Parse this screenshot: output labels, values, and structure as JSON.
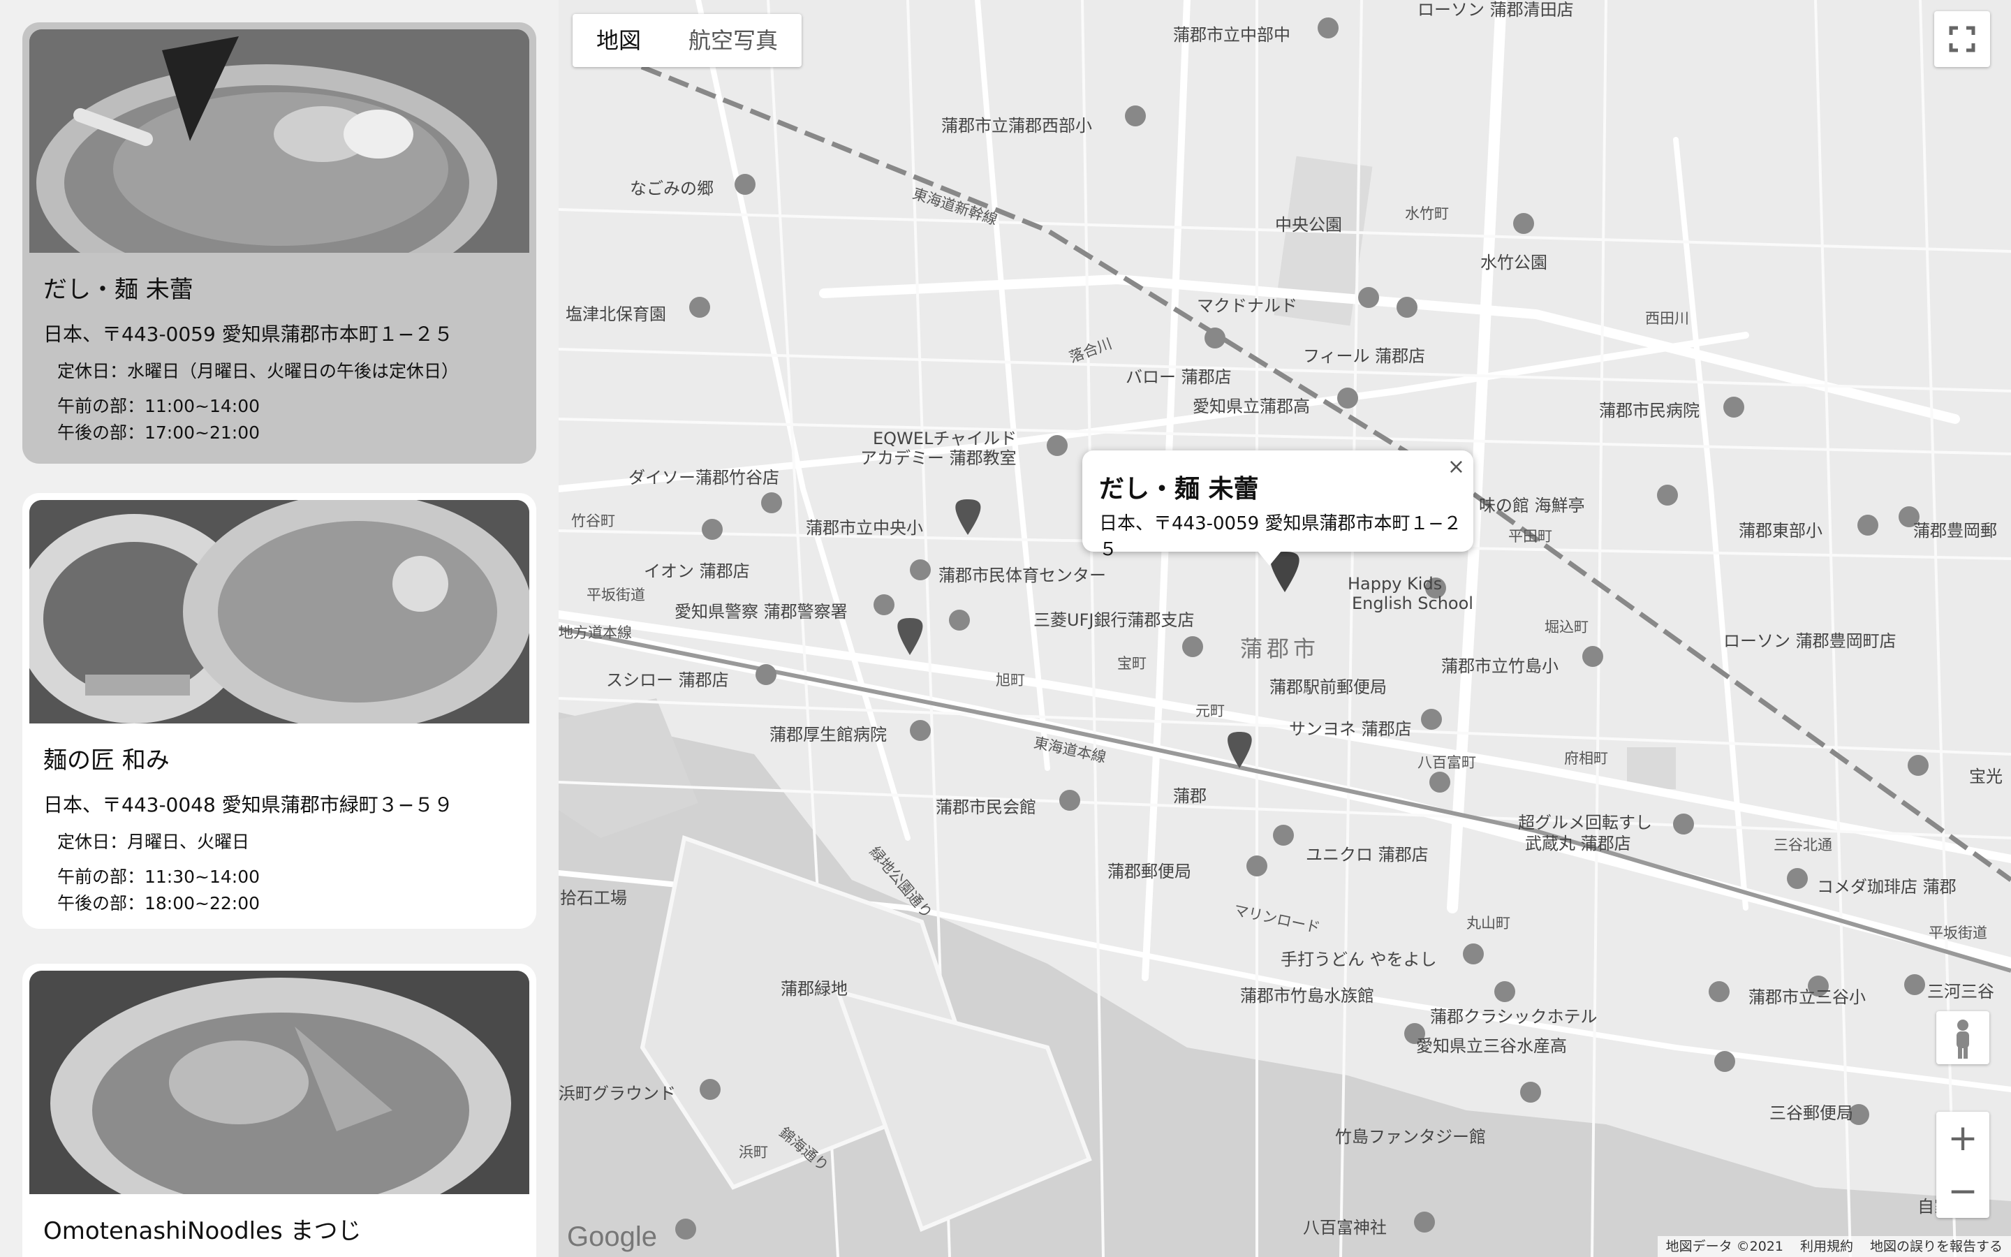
{
  "restaurants": [
    {
      "name": "だし・麺 未蕾",
      "address": "日本、〒443-0059 愛知県蒲郡市本町１−２５",
      "holiday": "定休日：水曜日（月曜日、火曜日の午後は定休日）",
      "am": "午前の部：11:00~14:00",
      "pm": "午後の部：17:00~21:00"
    },
    {
      "name": "麺の匠 和み",
      "address": "日本、〒443-0048 愛知県蒲郡市緑町３−５９",
      "holiday": "定休日：月曜日、火曜日",
      "am": "午前の部：11:30~14:00",
      "pm": "午後の部：18:00~22:00"
    },
    {
      "name": "OmotenashiNoodles まつじ"
    }
  ],
  "map": {
    "type_buttons": [
      "地図",
      "航空写真"
    ],
    "info": {
      "title": "だし・麺 未蕾",
      "address": "日本、〒443-0059 愛知県蒲郡市本町１−２５",
      "close": "×"
    },
    "labels": [
      "蒲郡市立中部中",
      "ローソン 蒲郡清田店",
      "蒲郡市立蒲郡西部小",
      "なごみの郷",
      "東海道新幹線",
      "中央公園",
      "水竹町",
      "水竹公園",
      "塩津北保育園",
      "マクドナルド",
      "西田川",
      "落合川",
      "フィール 蒲郡店",
      "バロー 蒲郡店",
      "愛知県立蒲郡高",
      "蒲郡市民病院",
      "EQWELチャイルド",
      "アカデミー 蒲郡教室",
      "ダイソー蒲郡竹谷店",
      "竹谷町",
      "蒲郡市立中央小",
      "味の館 海鮮亭",
      "平田町",
      "蒲郡東部小",
      "蒲郡豊岡郵",
      "イオン 蒲郡店",
      "蒲郡市民体育センター",
      "平坂街道",
      "愛知県警察 蒲郡警察署",
      "三菱UFJ銀行蒲郡支店",
      "Happy Kids",
      "English School",
      "堀込町",
      "ローソン 蒲郡豊岡町店",
      "旭町",
      "宝町",
      "蒲郡市",
      "スシロー 蒲郡店",
      "蒲郡駅前郵便局",
      "蒲郡市立竹島小",
      "元町",
      "蒲郡厚生館病院",
      "東海道本線",
      "サンヨネ 蒲郡店",
      "八百富町",
      "府相町",
      "宝光",
      "蒲郡市民会館",
      "蒲郡",
      "超グルメ回転すし",
      "武蔵丸 蒲郡店",
      "三谷北通",
      "ユニクロ 蒲郡店",
      "拾石工場",
      "蒲郡郵便局",
      "コメダ珈琲店 蒲郡",
      "マリンロード",
      "丸山町",
      "平坂街道",
      "手打うどん やをよし",
      "蒲郡市竹島水族館",
      "蒲郡緑地",
      "蒲郡市立三谷小",
      "三河三谷",
      "蒲郡クラシックホテル",
      "愛知県立三谷水産高",
      "竹島ファンタジー館",
      "三谷郵便局",
      "浜町グラウンド",
      "浜町",
      "八百富神社",
      "自家",
      "緑地公園通り",
      "錦海通り",
      "地方道本線"
    ],
    "footer": [
      "地図データ ©2021",
      "利用規約",
      "地図の誤りを報告する"
    ],
    "logo": "Google"
  }
}
